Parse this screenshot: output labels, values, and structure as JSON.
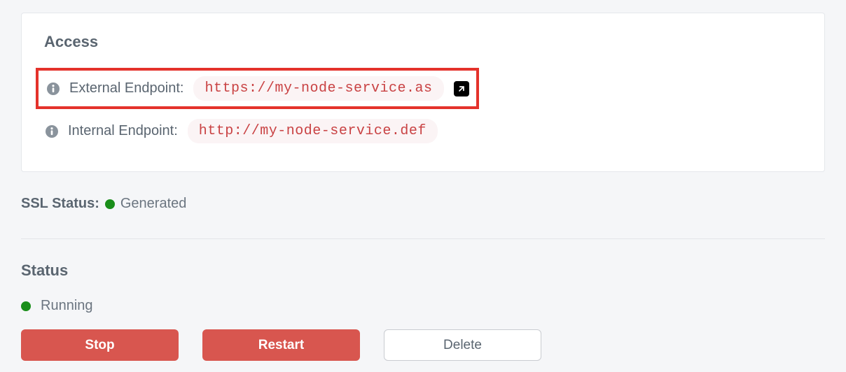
{
  "access": {
    "heading": "Access",
    "external": {
      "label": "External Endpoint:",
      "url": "https://my-node-service.as"
    },
    "internal": {
      "label": "Internal Endpoint:",
      "url": "http://my-node-service.def"
    }
  },
  "ssl": {
    "label": "SSL Status:",
    "value": "Generated",
    "status_color": "#1a8e1a"
  },
  "status": {
    "heading": "Status",
    "value": "Running",
    "status_color": "#1a8e1a"
  },
  "buttons": {
    "stop": "Stop",
    "restart": "Restart",
    "delete": "Delete"
  }
}
